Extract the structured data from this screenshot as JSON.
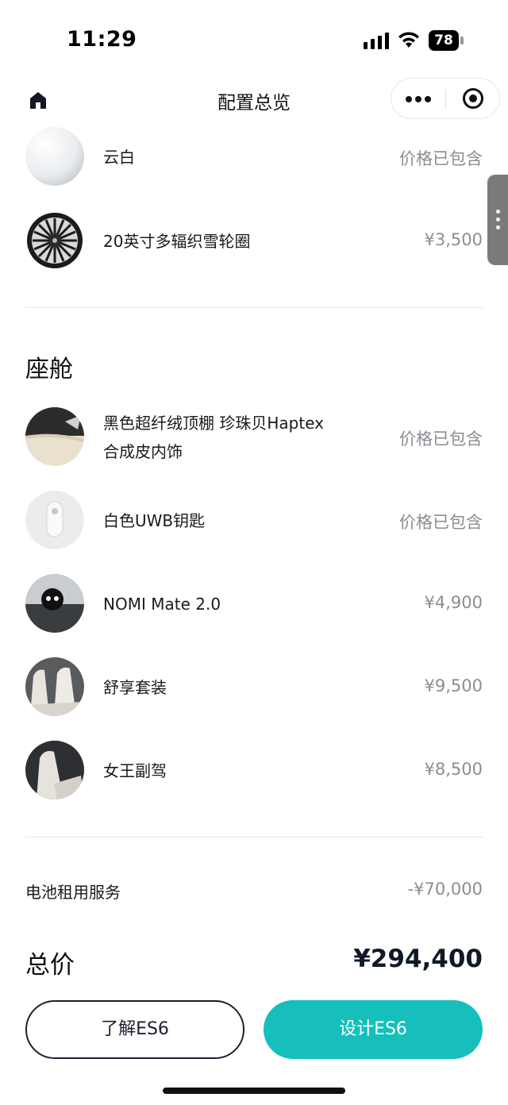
{
  "status_bar": {
    "time": "11:29",
    "battery": "78"
  },
  "nav": {
    "title": "配置总览"
  },
  "exterior_items": [
    {
      "label": "云白",
      "price": "价格已包含"
    },
    {
      "label": "20英寸多辐织雪轮圈",
      "price": "¥3,500"
    }
  ],
  "cabin": {
    "title": "座舱",
    "items": [
      {
        "label_line1": "黑色超纤绒顶棚 珍珠贝Haptex",
        "label_line2": "合成皮内饰",
        "price": "价格已包含"
      },
      {
        "label": "白色UWB钥匙",
        "price": "价格已包含"
      },
      {
        "label": "NOMI Mate 2.0",
        "price": "¥4,900"
      },
      {
        "label": "舒享套装",
        "price": "¥9,500"
      },
      {
        "label": "女王副驾",
        "price": "¥8,500"
      }
    ]
  },
  "battery_service": {
    "label": "电池租用服务",
    "value": "-¥70,000"
  },
  "total": {
    "label": "总价",
    "value": "¥294,400"
  },
  "buttons": {
    "learn": "了解ES6",
    "design": "设计ES6"
  },
  "colors": {
    "accent": "#16bfbb",
    "price_gray": "#8a8d93",
    "dark": "#1b2030"
  }
}
